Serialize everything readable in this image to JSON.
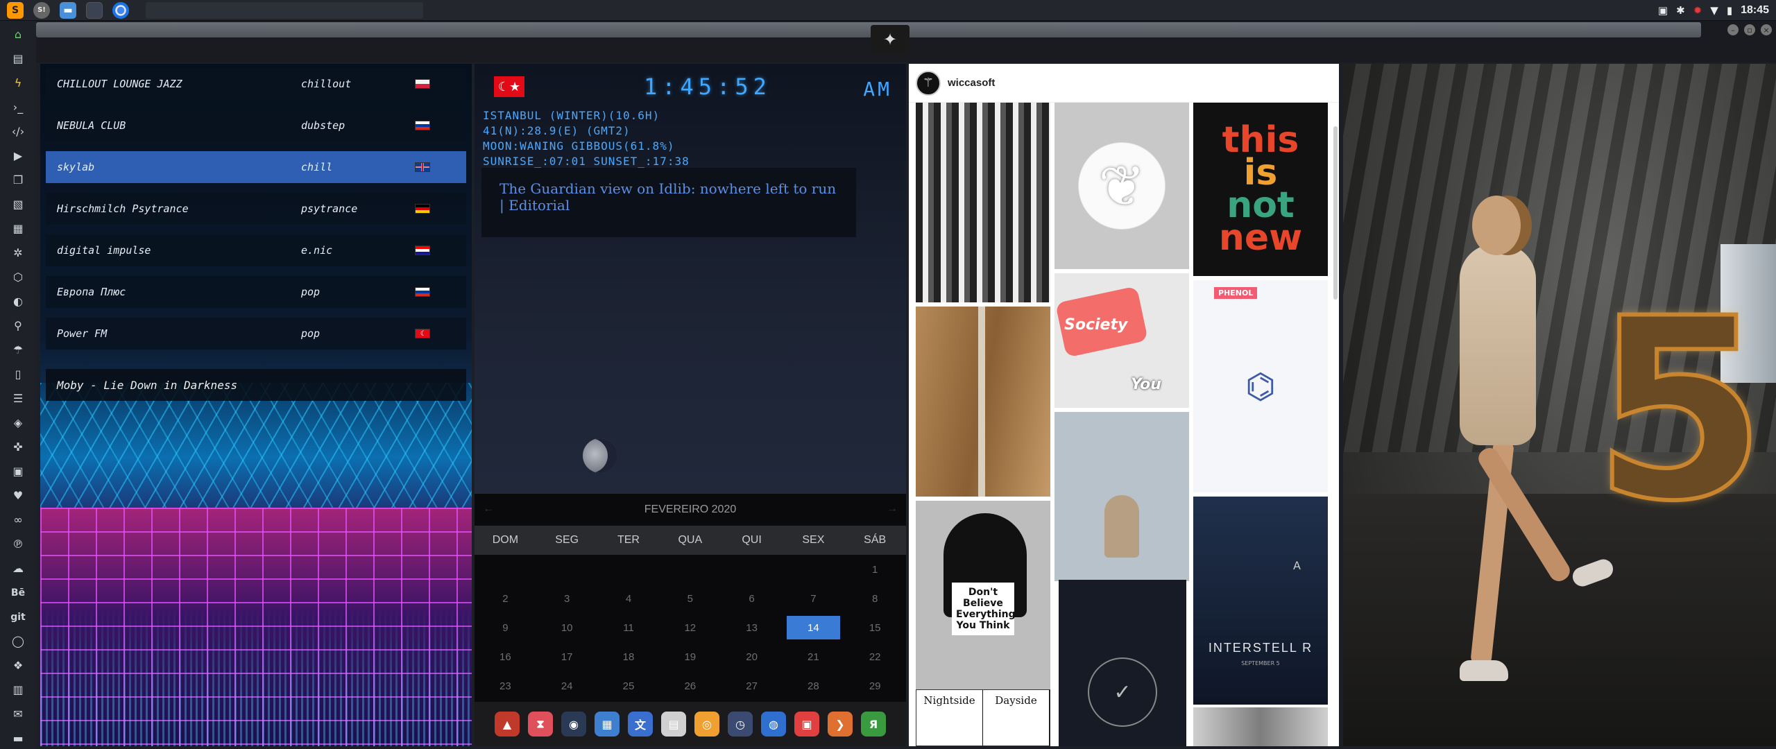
{
  "top_panel": {
    "launchers": [
      {
        "icon": "sublime-text-icon",
        "glyph": "S"
      },
      {
        "icon": "settings-circle-icon",
        "glyph": "S!"
      },
      {
        "icon": "folder-icon",
        "glyph": "▬"
      },
      {
        "icon": "terminal-icon",
        "glyph": ""
      },
      {
        "icon": "chrome-icon",
        "glyph": ""
      }
    ],
    "tray": {
      "time": "18:45"
    }
  },
  "sidebar": {
    "icons": [
      "home-icon",
      "document-icon",
      "bolt-icon",
      "terminal-prompt-icon",
      "code-icon",
      "play-icon",
      "copy-icon",
      "image-icon",
      "news-icon",
      "settings-icon",
      "network-icon",
      "globe-icon",
      "search-icon",
      "umbrella-icon",
      "phone-icon",
      "list-icon",
      "tag-icon",
      "puzzle-icon",
      "youtube-icon",
      "heart-icon",
      "link-icon",
      "pinterest-icon",
      "cloud-icon",
      "behance-icon",
      "git-icon",
      "github-icon",
      "cubes-icon",
      "map-icon",
      "mail-icon",
      "storage-icon"
    ],
    "text_labels": {
      "behance": "Bē",
      "git": "git"
    }
  },
  "radio": {
    "stations": [
      {
        "name": "CHILLOUT LOUNGE JAZZ",
        "genre": "chillout",
        "flag": "pl"
      },
      {
        "name": "NEBULA CLUB",
        "genre": "dubstep",
        "flag": "ru"
      },
      {
        "name": "skylab",
        "genre": "chill",
        "flag": "uk"
      },
      {
        "name": "Hirschmilch Psytrance",
        "genre": "psytrance",
        "flag": "de"
      },
      {
        "name": "digital impulse",
        "genre": "e.nic",
        "flag": "hr"
      },
      {
        "name": "Европа Плюс",
        "genre": "pop",
        "flag": "ru"
      },
      {
        "name": "Power FM",
        "genre": "pop",
        "flag": "tr"
      }
    ],
    "active_index": 2,
    "now_playing": "Moby - Lie Down in Darkness"
  },
  "clock": {
    "time": "1:45:52",
    "ampm": "AM",
    "weather_lines": [
      "ISTANBUL (WINTER)(10.6H)",
      "41(N):28.9(E) (GMT2)",
      "MOON:WANING GIBBOUS(61.8%)",
      "SUNRISE_:07:01 SUNSET_:17:38"
    ],
    "news": "The Guardian view on Idlib: nowhere left to run | Editorial"
  },
  "calendar": {
    "month": "FEVEREIRO 2020",
    "days": [
      "DOM",
      "SEG",
      "TER",
      "QUA",
      "QUI",
      "SEX",
      "SÁB"
    ],
    "cells": [
      "",
      "",
      "",
      "",
      "",
      "",
      "1",
      "2",
      "3",
      "4",
      "5",
      "6",
      "7",
      "8",
      "9",
      "10",
      "11",
      "12",
      "13",
      "14",
      "15",
      "16",
      "17",
      "18",
      "19",
      "20",
      "21",
      "22",
      "23",
      "24",
      "25",
      "26",
      "27",
      "28",
      "29"
    ],
    "today": "14"
  },
  "dock": [
    {
      "icon": "arch-icon",
      "color": "#c0392b",
      "glyph": "▲"
    },
    {
      "icon": "hourglass-icon",
      "color": "#e0505a",
      "glyph": "⧗"
    },
    {
      "icon": "globe-dark-icon",
      "color": "#2a3a55",
      "glyph": "◉"
    },
    {
      "icon": "image-viewer-icon",
      "color": "#3f7fd0",
      "glyph": "▦"
    },
    {
      "icon": "translate-icon",
      "color": "#3a6fd0",
      "glyph": "文"
    },
    {
      "icon": "news-reader-icon",
      "color": "#d0d0d0",
      "glyph": "▤"
    },
    {
      "icon": "search-app-icon",
      "color": "#f0a030",
      "glyph": "◎"
    },
    {
      "icon": "clock-app-icon",
      "color": "#3a4a70",
      "glyph": "◷"
    },
    {
      "icon": "web-icon",
      "color": "#2f6fd0",
      "glyph": "◍"
    },
    {
      "icon": "calendar-app-icon",
      "color": "#e04040",
      "glyph": "▣"
    },
    {
      "icon": "arrow-app-icon",
      "color": "#e07030",
      "glyph": "❯"
    },
    {
      "icon": "yandex-icon",
      "color": "#3a9a40",
      "glyph": "Я"
    }
  ],
  "insta": {
    "username": "wiccasoft",
    "tiles": {
      "thisis": [
        "this",
        "is",
        "not",
        "new"
      ],
      "society": [
        "Society",
        "You"
      ],
      "face_sign": "Don't Believe Everything You Think",
      "chem_label": "PHENOL",
      "interstellar": "INTERSTELL R",
      "interstellar_a": "A",
      "interstellar_date": "SEPTEMBER 5",
      "nightside": "Nightside",
      "dayside": "Dayside"
    }
  },
  "colors": {
    "accent_blue": "#3a7bd5",
    "clock_blue": "#3fa7ff",
    "station_active": "#2f5fb3"
  }
}
